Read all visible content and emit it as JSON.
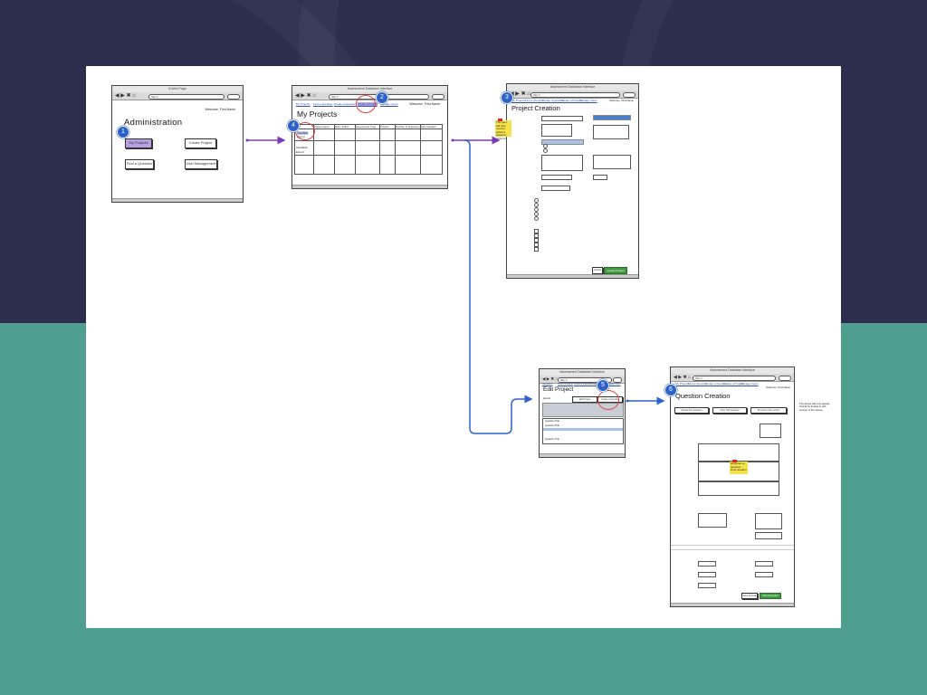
{
  "colors": {
    "background_top": "#2d2d50",
    "background_bottom": "#4fa08e",
    "board": "#ffffff",
    "flow_purple": "#7a3bb8",
    "flow_blue": "#2f62c8",
    "badge": "#2f62c8",
    "highlight_ring": "#e03a3a"
  },
  "badges": [
    "1",
    "2",
    "3",
    "4",
    "5",
    "6"
  ],
  "screen1": {
    "window_title": "A Web Page",
    "welcome": "Welcome, First Name",
    "title": "Administration",
    "buttons": [
      "My Projects",
      "Create Project",
      "Find a Question",
      "User Management"
    ]
  },
  "screen2": {
    "window_title": "Assessment Database Interface",
    "links": [
      "My Projects",
      "Find a Question",
      "Create a Question",
      "Create a Project",
      "Manage Users"
    ],
    "welcome": "Welcome, First Name",
    "title": "My Projects",
    "table_headers": [
      "Project Name",
      "Role / Editor",
      "Assessment Type",
      "Product",
      "Number of Questions",
      "Last Updated"
    ],
    "row_actions": [
      "View/Edit",
      "Export"
    ],
    "side_actions": [
      "View/Edit",
      "Export"
    ]
  },
  "screen3": {
    "window_title": "Assessment Database Interface",
    "links": [
      "My Projects",
      "Find a Question",
      "Create a Question",
      "Create a Project",
      "Manage Users"
    ],
    "welcome": "Welcome, First Name",
    "title": "Project Creation",
    "sticky_note": "The user will only need to select a question schema",
    "primary_button": "Create Project",
    "secondary_button": "Cancel"
  },
  "screen5": {
    "window_title": "Assessment Database Interface",
    "links": [
      "Navigation",
      "Find a Question",
      "Create a Question",
      "Create a Project",
      "Manage Users"
    ],
    "title": "Edit Project",
    "export_label": "Export",
    "buttons": [
      "Edit Project",
      "Create a Question"
    ],
    "list_items": [
      "Question Title",
      "Question Title",
      "Question Title"
    ]
  },
  "screen6": {
    "window_title": "Assessment Database Interface",
    "links": [
      "My Projects",
      "Find a Question",
      "Create a Question",
      "Create a Project",
      "Manage Users"
    ],
    "welcome": "Welcome, First Name",
    "title": "Question Creation",
    "top_buttons": [
      "Reuse this question",
      "Copy this question",
      "Re-point to this version"
    ],
    "side_note": "The above will only appear, should be limited to edit version of the screen",
    "sticky_note": "Required at question level creation",
    "bottom_buttons": [
      "Save as Draft",
      "Submit Question"
    ]
  }
}
